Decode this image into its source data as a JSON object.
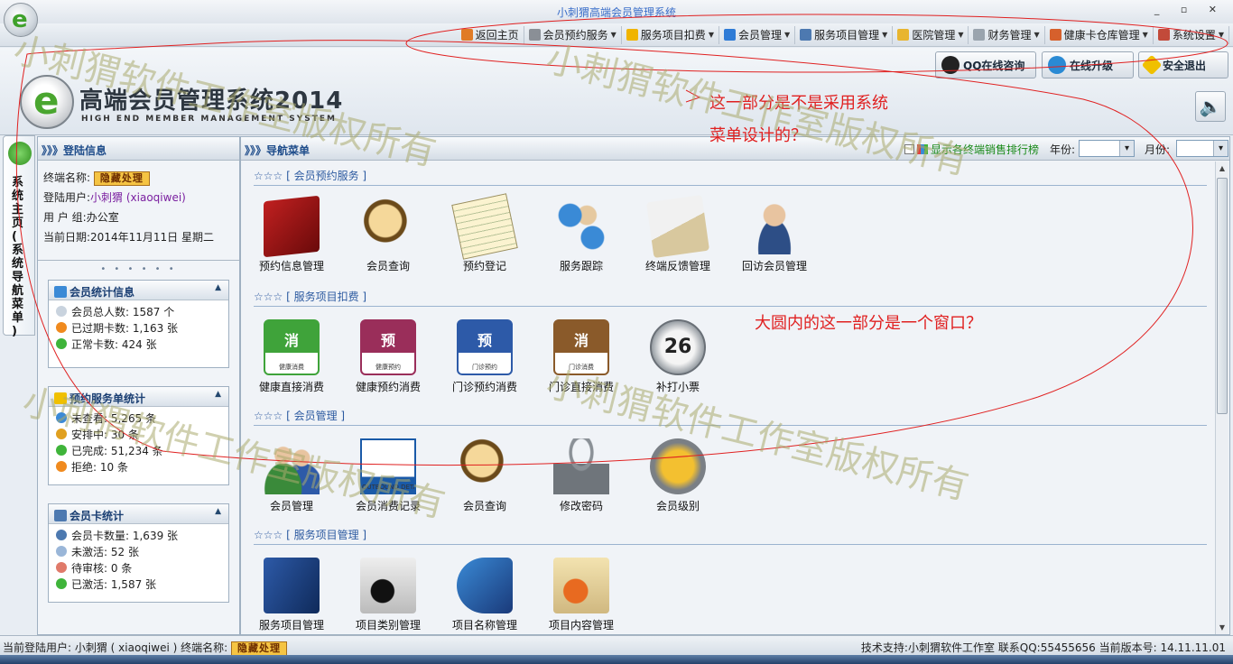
{
  "window": {
    "title": "小刺猬高端会员管理系统",
    "controls": "_ ▫ ✕"
  },
  "menu": [
    {
      "label": "返回主页",
      "icon": "home-icon",
      "dropdown": false,
      "color": "#e07b25"
    },
    {
      "label": "会员预约服务",
      "icon": "calendar-icon",
      "dropdown": true,
      "color": "#8a8f96"
    },
    {
      "label": "服务项目扣费",
      "icon": "star-icon",
      "dropdown": true,
      "color": "#f0b400"
    },
    {
      "label": "会员管理",
      "icon": "user-icon",
      "dropdown": true,
      "color": "#2e7bd6"
    },
    {
      "label": "服务项目管理",
      "icon": "list-icon",
      "dropdown": true,
      "color": "#4d79b0"
    },
    {
      "label": "医院管理",
      "icon": "folder-icon",
      "dropdown": true,
      "color": "#e8b52f"
    },
    {
      "label": "财务管理",
      "icon": "document-icon",
      "dropdown": true,
      "color": "#9aa4ae"
    },
    {
      "label": "健康卡仓库管理",
      "icon": "tag-icon",
      "dropdown": true,
      "color": "#d6602c"
    },
    {
      "label": "系统设置",
      "icon": "tools-icon",
      "dropdown": true,
      "color": "#c24a3a"
    }
  ],
  "banner": {
    "title": "高端会员管理系统2014",
    "subtitle": "HIGH END MEMBER MANAGEMENT SYSTEM",
    "buttons": [
      {
        "label": "QQ在线咨询",
        "icon": "qq-icon",
        "color": "#222"
      },
      {
        "label": "在线升级",
        "icon": "globe-icon",
        "color": "#2a8ad4"
      },
      {
        "label": "安全退出",
        "icon": "exit-icon",
        "color": "#f0c000"
      }
    ],
    "speaker": "🔈"
  },
  "vertical_tab": {
    "label": "系统主页(系统导航菜单)"
  },
  "login_panel": {
    "header": "》》》登陆信息",
    "terminal_label": "终端名称:",
    "terminal_value": "隐藏处理",
    "user_label": "登陆用户:",
    "user_value": "小刺猬 (xiaoqiwei)",
    "group_label": "用 户 组:",
    "group_value": "办公室",
    "date_label": "当前日期:",
    "date_value": "2014年11月11日 星期二",
    "dots": "• • • • • •"
  },
  "stats": [
    {
      "title": "会员统计信息",
      "rows": [
        "会员总人数: 1587 个",
        "已过期卡数: 1,163 张",
        "正常卡数: 424 张"
      ],
      "row_colors": [
        "#c9d3de",
        "#f08a1e",
        "#3fb43a"
      ]
    },
    {
      "title": "预约服务单统计",
      "rows": [
        "未查看: 5,265 条",
        "安排中: 30 条",
        "已完成: 51,234 条",
        "拒绝: 10 条"
      ],
      "row_colors": [
        "#3b8ad6",
        "#e0a020",
        "#3fb43a",
        "#f08a1e"
      ]
    },
    {
      "title": "会员卡统计",
      "rows": [
        "会员卡数量: 1,639 张",
        "未激活: 52 张",
        "待审核: 0 条",
        "已激活: 1,587 张"
      ],
      "row_colors": [
        "#4d79b0",
        "#9ab6d8",
        "#e07a6a",
        "#3fb43a"
      ]
    }
  ],
  "nav": {
    "header": "》》》导航菜单",
    "rank_label": "显示各终端销售排行榜",
    "year_label": "年份:",
    "month_label": "月份:",
    "sections": [
      {
        "title": "☆☆☆ [ 会员预约服务 ]",
        "items": [
          {
            "label": "预约信息管理",
            "icon": "appointment-book-icon"
          },
          {
            "label": "会员查询",
            "icon": "magnifier-icon"
          },
          {
            "label": "预约登记",
            "icon": "notepad-icon"
          },
          {
            "label": "服务跟踪",
            "icon": "tracking-icon"
          },
          {
            "label": "终端反馈管理",
            "icon": "feedback-pen-icon"
          },
          {
            "label": "回访会员管理",
            "icon": "headset-agent-icon"
          }
        ]
      },
      {
        "title": "☆☆☆ [ 服务项目扣费 ]",
        "items": [
          {
            "label": "健康直接消费",
            "icon": "health-consume-icon",
            "badge": "消",
            "sub": "健康消费"
          },
          {
            "label": "健康预约消费",
            "icon": "health-booking-icon",
            "badge": "预",
            "sub": "健康预约"
          },
          {
            "label": "门诊预约消费",
            "icon": "clinic-booking-icon",
            "badge": "预",
            "sub": "门诊预约"
          },
          {
            "label": "门诊直接消费",
            "icon": "clinic-consume-icon",
            "badge": "消",
            "sub": "门诊消费"
          },
          {
            "label": "补打小票",
            "icon": "reprint-ticket-icon",
            "badge": "26"
          }
        ]
      },
      {
        "title": "☆☆☆ [ 会员管理 ]",
        "items": [
          {
            "label": "会员管理",
            "icon": "members-icon"
          },
          {
            "label": "会员消费记录",
            "icon": "consume-record-icon",
            "sub": "OUTBOUND DETAILS"
          },
          {
            "label": "会员查询",
            "icon": "magnifier-icon"
          },
          {
            "label": "修改密码",
            "icon": "padlock-icon"
          },
          {
            "label": "会员级别",
            "icon": "member-level-icon"
          }
        ]
      },
      {
        "title": "☆☆☆ [ 服务项目管理 ]",
        "items": [
          {
            "label": "服务项目管理",
            "icon": "service-item-icon"
          },
          {
            "label": "项目类别管理",
            "icon": "category-icon"
          },
          {
            "label": "项目名称管理",
            "icon": "name-icon"
          },
          {
            "label": "项目内容管理",
            "icon": "content-icon"
          }
        ]
      }
    ]
  },
  "statusbar": {
    "user_label": "当前登陆用户: 小刺猬 ( xiaoqiwei )  终端名称:",
    "terminal_value": "隐藏处理",
    "right": "技术支持:小刺猬软件工作室 联系QQ:55455656 当前版本号: 14.11.11.01"
  },
  "annotations": {
    "menu_question": "这一部分是不是采用系统",
    "menu_question_2": "菜单设计的？",
    "window_question": "大圆内的这一部分是一个窗口？"
  },
  "watermark": "小刺猬软件工作室版权所有"
}
